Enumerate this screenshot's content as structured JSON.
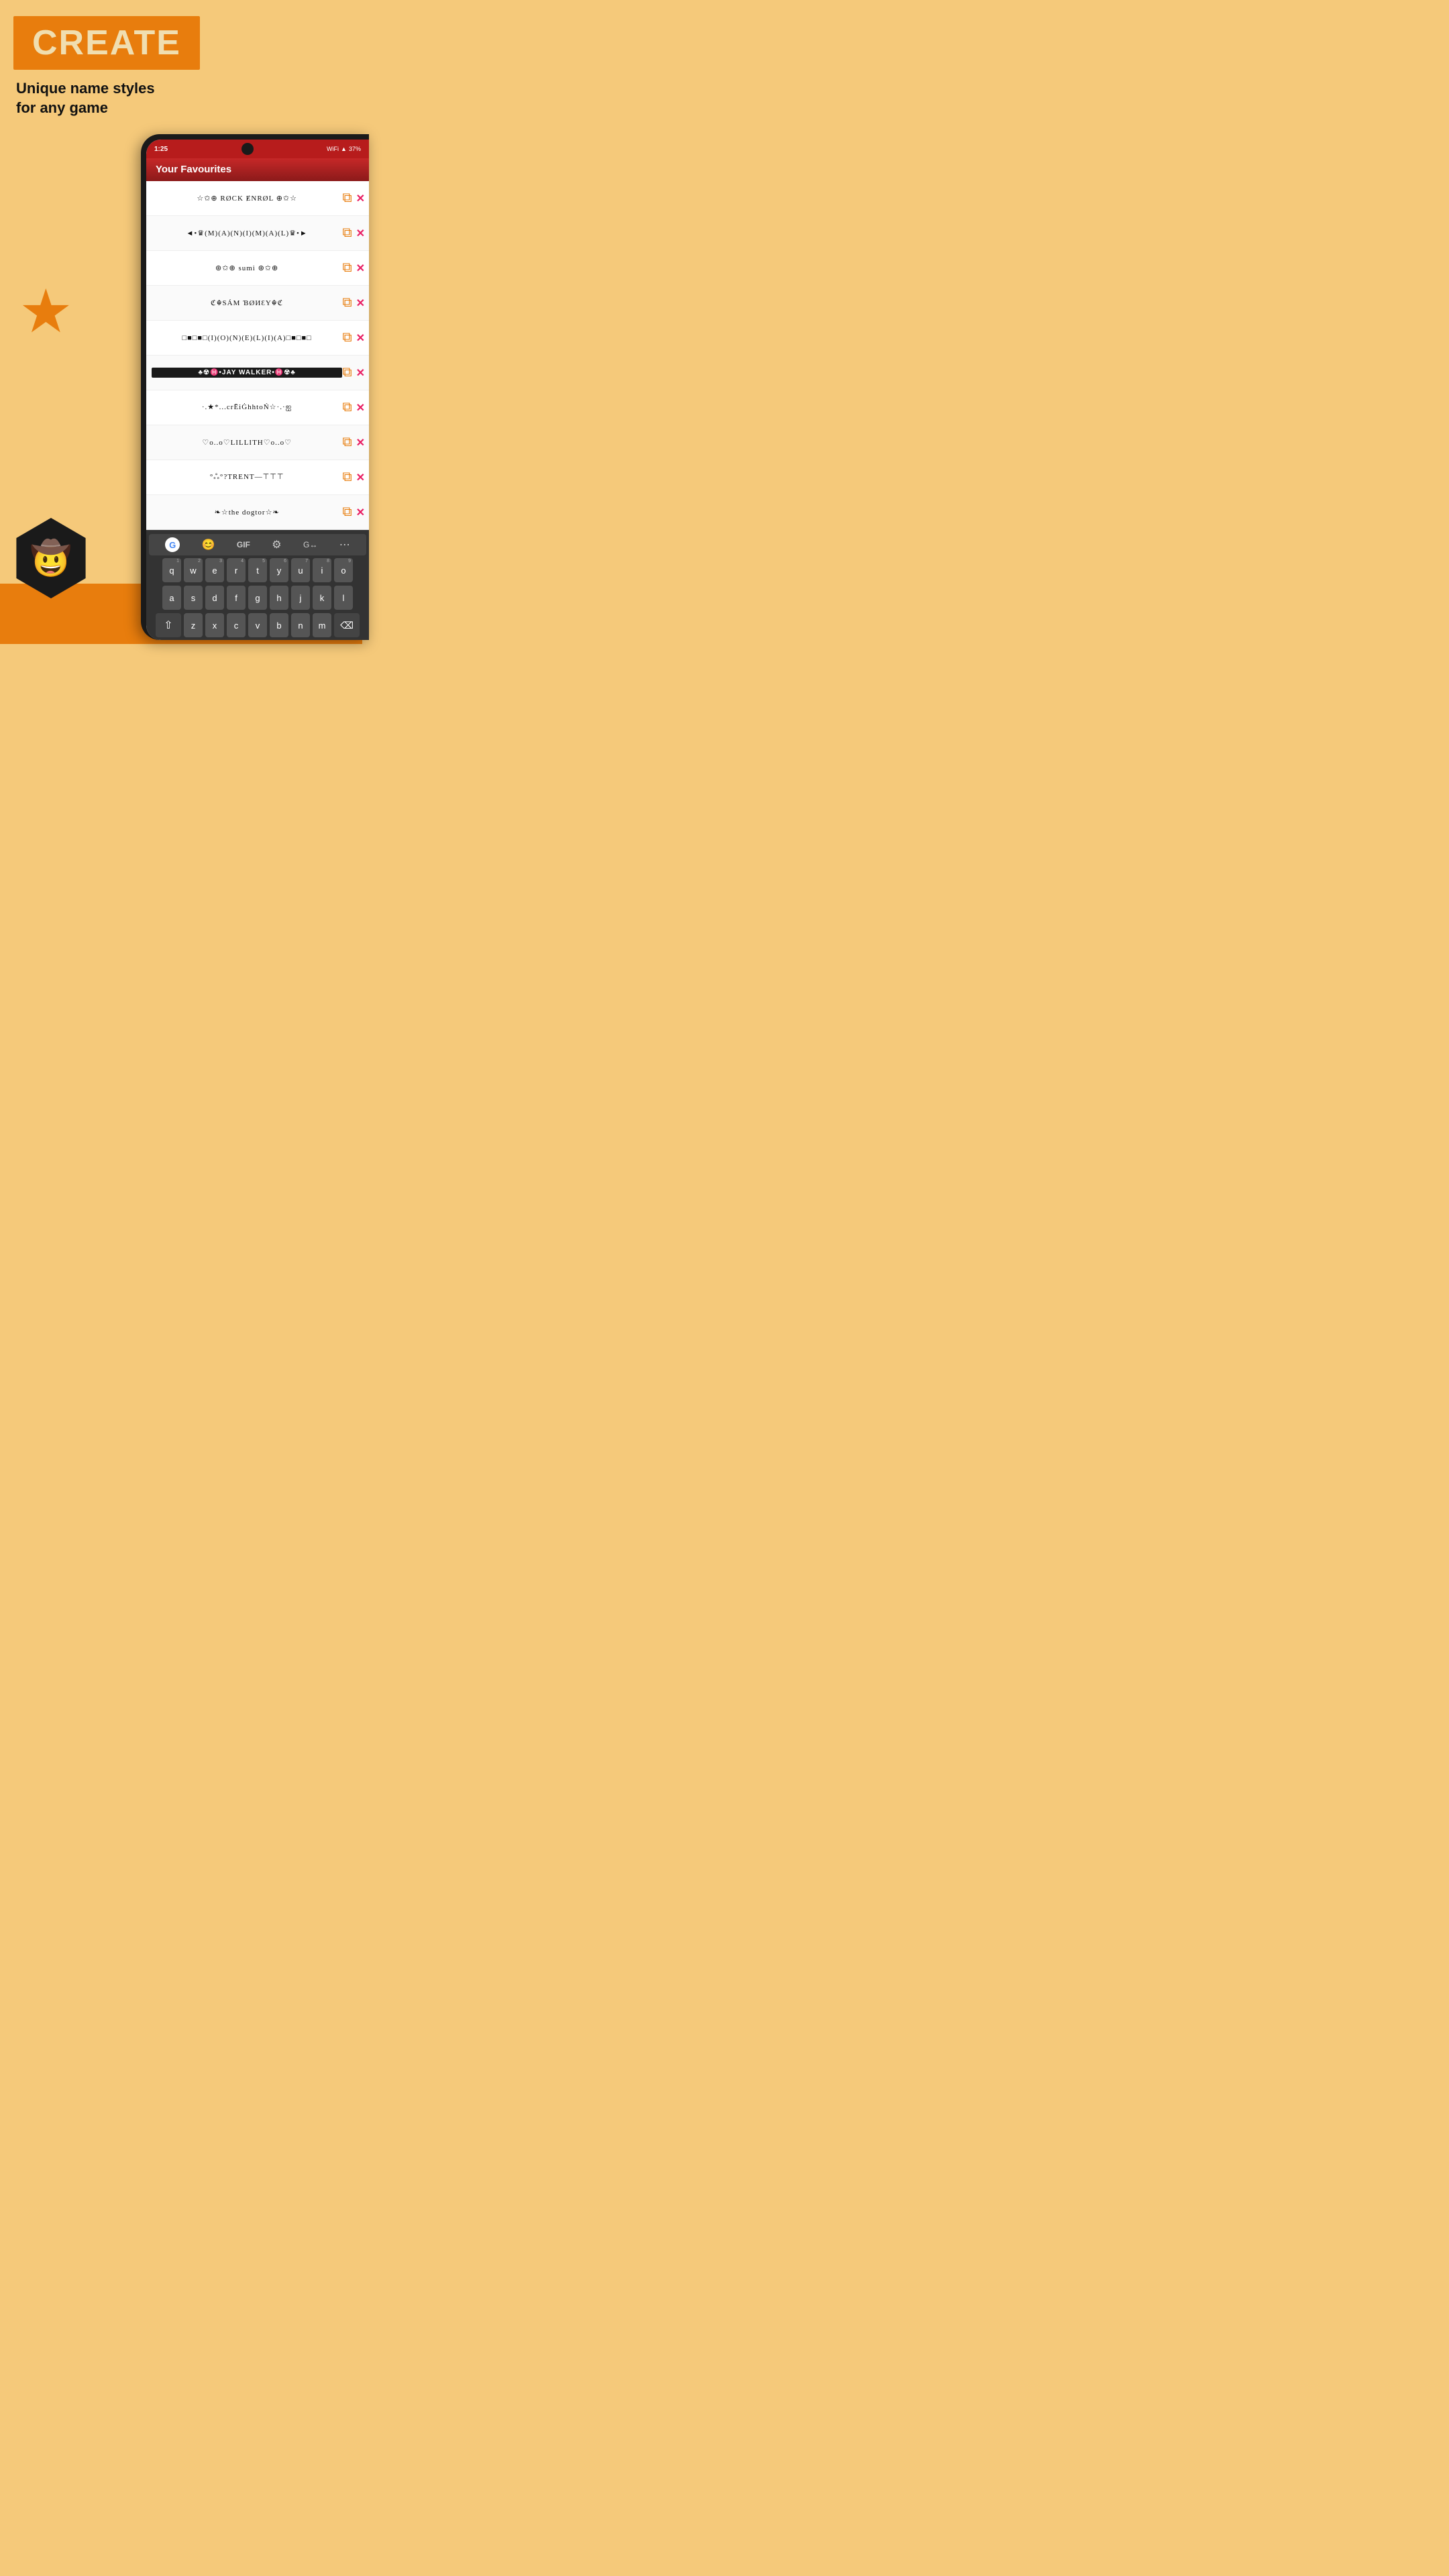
{
  "page": {
    "background_color": "#f5c97a",
    "bottom_bar_color": "#e87d0d"
  },
  "header": {
    "banner_color": "#e87d0d",
    "create_label": "CREATE",
    "tagline_line1": "Unique name styles",
    "tagline_line2": "for any game"
  },
  "star": {
    "symbol": "★",
    "color": "#e87d0d"
  },
  "logo": {
    "symbol": "🤠"
  },
  "phone": {
    "status": {
      "time": "1:25",
      "battery": "37%",
      "wifi": "WiFi"
    },
    "app_title": "Your Favourites",
    "favourites": [
      {
        "id": 1,
        "name": "☆✩⊕ RØCK ɆNRØL ⊕✩☆"
      },
      {
        "id": 2,
        "name": "◄•♛(M)(A)(N)(I)(M)(A)(L)♛•►"
      },
      {
        "id": 3,
        "name": "⊛✩⊕ sumi ⊛✩⊕"
      },
      {
        "id": 4,
        "name": "ℭ☬SÁM ƁØИƐY☬ℭ"
      },
      {
        "id": 5,
        "name": "□■□■□(I)(O)(N)(E)(L)(I)(A)□■□■□"
      },
      {
        "id": 6,
        "name": "♣☢♓•JAY WALKER•♓☢♣"
      },
      {
        "id": 7,
        "name": "·.★*...crĒiĠhhtоŃ☆·.·ஐ"
      },
      {
        "id": 8,
        "name": "♡о..о♡LILLITH♡о..о♡"
      },
      {
        "id": 9,
        "name": "°ஃ°?TRENT—⊤⊤⊤"
      },
      {
        "id": 10,
        "name": "❧☆the dogtor☆❧"
      }
    ],
    "copy_icon": "⧉",
    "delete_icon": "✕",
    "keyboard": {
      "toolbar_icons": [
        "G",
        "😊",
        "GIF",
        "⚙",
        "G-",
        "⋯"
      ],
      "rows": [
        [
          "q1",
          "w2",
          "e3",
          "r4",
          "t5",
          "y6",
          "u7",
          "i8",
          "o9"
        ],
        [
          "a",
          "s",
          "d",
          "f",
          "g",
          "h",
          "j",
          "k",
          "l"
        ],
        [
          "⇧",
          "z",
          "x",
          "c",
          "v",
          "b",
          "n",
          "m",
          "⌫"
        ]
      ]
    }
  }
}
